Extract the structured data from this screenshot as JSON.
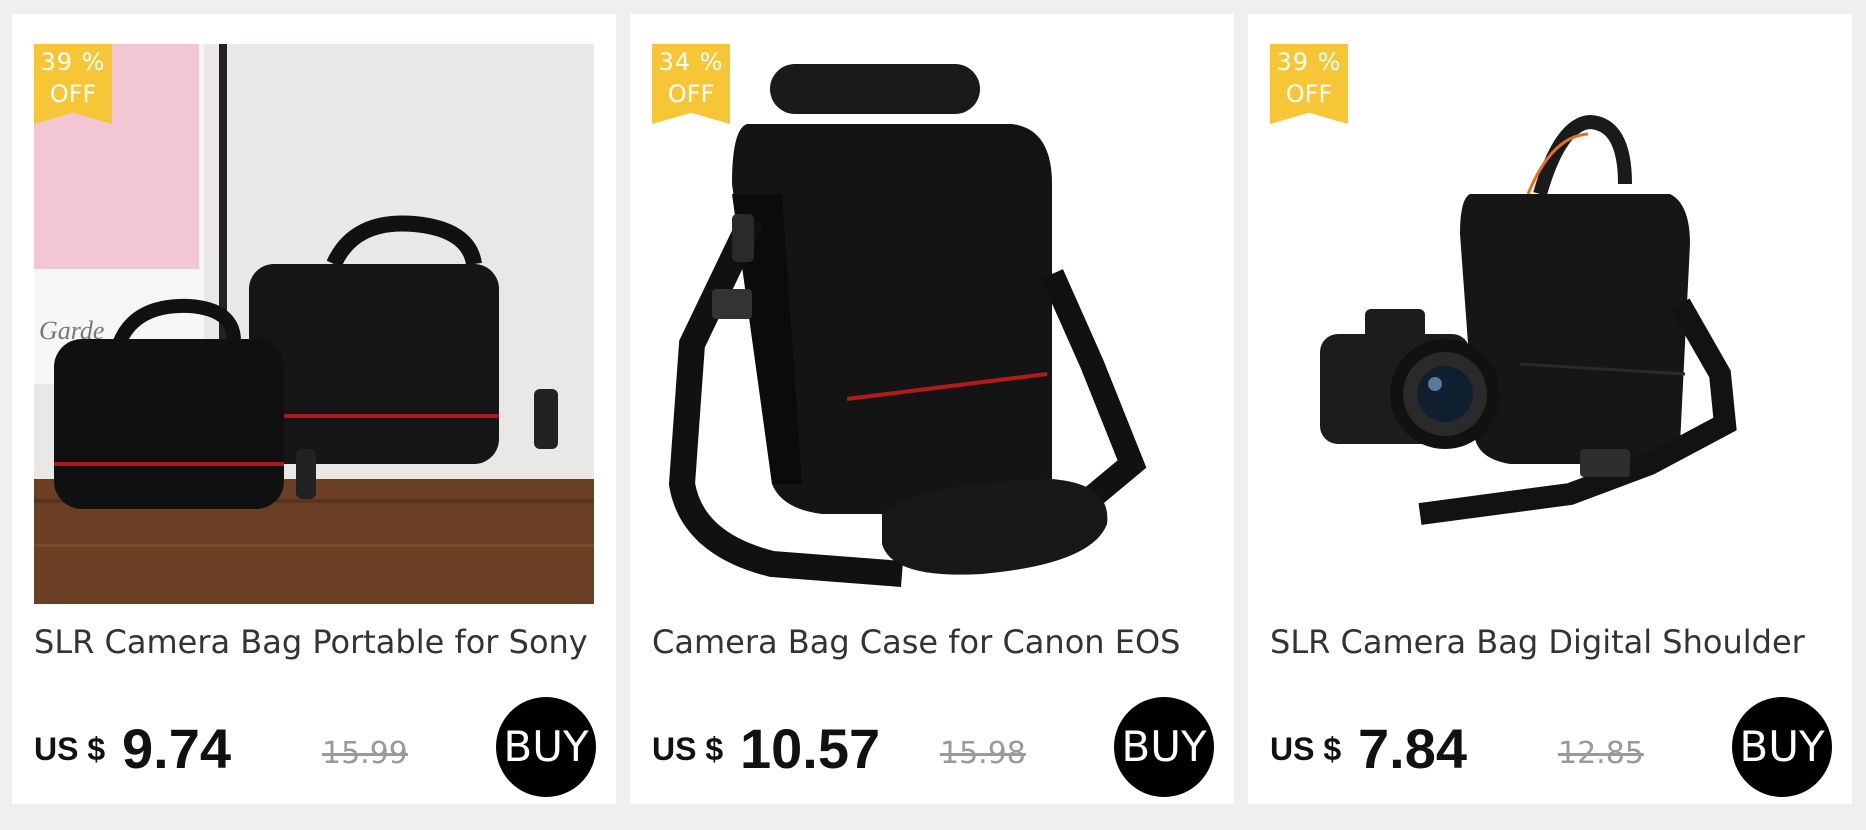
{
  "colors": {
    "badge_bg": "#f7c637",
    "buy_bg": "#000000",
    "page_bg": "#efefef"
  },
  "products": [
    {
      "discount_pct": "39 %",
      "discount_off": "OFF",
      "title": "SLR Camera Bag Portable for Sony",
      "currency": "US $",
      "price": "9.74",
      "original_price": "15.99",
      "buy_label": "BUY"
    },
    {
      "discount_pct": "34 %",
      "discount_off": "OFF",
      "title": "Camera Bag Case for Canon EOS",
      "currency": "US $",
      "price": "10.57",
      "original_price": "15.98",
      "buy_label": "BUY"
    },
    {
      "discount_pct": "39 %",
      "discount_off": "OFF",
      "title": "SLR Camera Bag Digital Shoulder",
      "currency": "US $",
      "price": "7.84",
      "original_price": "12.85",
      "buy_label": "BUY"
    }
  ]
}
